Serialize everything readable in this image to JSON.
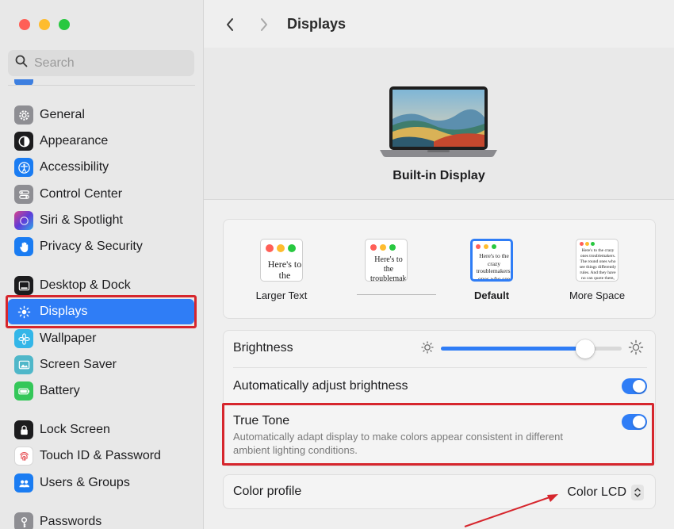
{
  "window": {
    "title": "Displays"
  },
  "colors": {
    "accent": "#2f7df6",
    "highlight": "#d6262d",
    "close": "#ff5f57",
    "minimize": "#febc2e",
    "zoom": "#28c840"
  },
  "search": {
    "placeholder": "Search"
  },
  "sidebar": {
    "items": [
      {
        "label": "General",
        "icon": "gear-icon"
      },
      {
        "label": "Appearance",
        "icon": "appearance-icon"
      },
      {
        "label": "Accessibility",
        "icon": "accessibility-icon"
      },
      {
        "label": "Control Center",
        "icon": "control-center-icon"
      },
      {
        "label": "Siri & Spotlight",
        "icon": "siri-icon"
      },
      {
        "label": "Privacy & Security",
        "icon": "hand-icon"
      },
      {
        "label": "Desktop & Dock",
        "icon": "dock-icon"
      },
      {
        "label": "Displays",
        "icon": "sun-icon",
        "selected": true
      },
      {
        "label": "Wallpaper",
        "icon": "flower-icon"
      },
      {
        "label": "Screen Saver",
        "icon": "screen-saver-icon"
      },
      {
        "label": "Battery",
        "icon": "battery-icon"
      },
      {
        "label": "Lock Screen",
        "icon": "lock-icon"
      },
      {
        "label": "Touch ID & Password",
        "icon": "fingerprint-icon"
      },
      {
        "label": "Users & Groups",
        "icon": "users-icon"
      },
      {
        "label": "Passwords",
        "icon": "key-icon"
      }
    ]
  },
  "main": {
    "display_name": "Built-in Display",
    "resolution": {
      "options": [
        {
          "label": "Larger Text",
          "preview": "Here's to the troublemakers"
        },
        {
          "label": "",
          "preview": "Here's to the troublemakers, ones who"
        },
        {
          "label": "Default",
          "preview": "Here's to the crazy troublemakers, ones who see things rules. And they",
          "selected": true
        },
        {
          "label": "More Space",
          "preview": "Here's to the crazy ones troublemakers. The round ones who see things differently rules. And they have no can quote them, disagree About the only thing Because they change things"
        }
      ]
    },
    "brightness": {
      "label": "Brightness",
      "value": 0.8
    },
    "auto_brightness": {
      "label": "Automatically adjust brightness",
      "on": true
    },
    "true_tone": {
      "label": "True Tone",
      "description": "Automatically adapt display to make colors appear consistent in different ambient lighting conditions.",
      "on": true
    },
    "color_profile": {
      "label": "Color profile",
      "value": "Color LCD"
    }
  }
}
